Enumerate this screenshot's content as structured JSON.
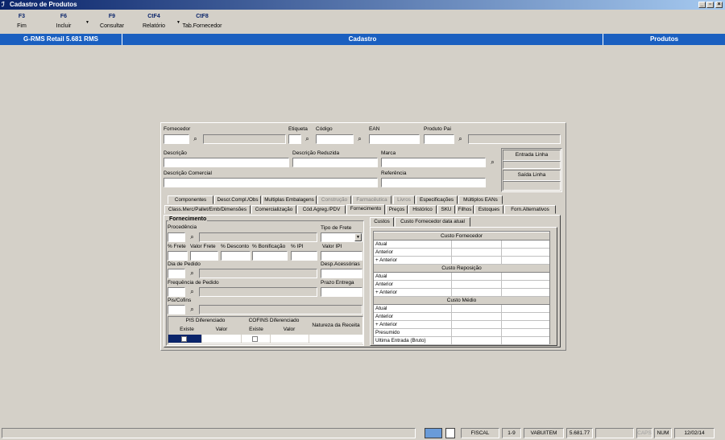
{
  "window": {
    "title": "Cadastro de Produtos"
  },
  "toolbar": [
    {
      "key": "F3",
      "label": "Fim"
    },
    {
      "key": "F6",
      "label": "Incluir"
    },
    {
      "key": "F9",
      "label": "Consultar"
    },
    {
      "key": "CtF4",
      "label": "Relatório"
    },
    {
      "key": "CtF8",
      "label": "Tab.Fornecedor"
    }
  ],
  "header": {
    "app": "G-RMS Retail 5.681 RMS",
    "section": "Cadastro",
    "module": "Produtos"
  },
  "fields": {
    "fornecedor": "Fornecedor",
    "etiqueta": "Etiqueta",
    "codigo": "Código",
    "ean": "EAN",
    "produto_pai": "Produto Pai",
    "descricao": "Descrição",
    "descricao_reduzida": "Descrição Reduzida",
    "marca": "Marca",
    "descricao_comercial": "Descrição Comercial",
    "referencia": "Referência",
    "entrada_linha": "Entrada Linha",
    "saida_linha": "Saída Linha"
  },
  "tabs_row1": [
    {
      "label": "Componentes",
      "enabled": true
    },
    {
      "label": "Descr.Compl./Obs",
      "enabled": true
    },
    {
      "label": "Multiplas Embalagens",
      "enabled": true
    },
    {
      "label": "Construção",
      "enabled": false
    },
    {
      "label": "Farmacêutica",
      "enabled": false
    },
    {
      "label": "Livros",
      "enabled": false
    },
    {
      "label": "Especificações",
      "enabled": true
    },
    {
      "label": "Múltiplos EANs",
      "enabled": true
    }
  ],
  "tabs_row2": [
    {
      "label": "Class.Merc/Pallet/Emb/Dimensões"
    },
    {
      "label": "Comercialização"
    },
    {
      "label": "Cód.Agreg./PDV"
    },
    {
      "label": "Fornecimento"
    },
    {
      "label": "Preços"
    },
    {
      "label": "Histórico"
    },
    {
      "label": "SKU"
    },
    {
      "label": "Filhos"
    },
    {
      "label": "Estoques"
    },
    {
      "label": "Forn.Alternativos"
    }
  ],
  "fornecimento": {
    "group_title": "Fornecimento",
    "procedencia": "Procedência",
    "tipo_frete": "Tipo de Frete",
    "pct_frete": "% Frete",
    "valor_frete": "Valor Frete",
    "pct_desconto": "% Desconto",
    "pct_bonificacao": "% Bonificação",
    "pct_ipi": "% IPI",
    "valor_ipi": "Valor IPI",
    "dia_pedido": "Dia de Pedido",
    "desp_acessorias": "Desp.Acessórias",
    "frequencia_pedido": "Frequência de Pedido",
    "prazo_entrega": "Prazo Entrega",
    "pis_cofins": "Pis/Cofins",
    "pis_dif": "PIS Diferenciado",
    "cofins_dif": "COFINS Diferenciado",
    "natureza_receita": "Natureza da Receita",
    "existe": "Existe",
    "valor": "Valor"
  },
  "custos": {
    "tabs": [
      "Custos",
      "Custo Fornecedor data atual"
    ],
    "sections": [
      {
        "title": "Custo Fornecedor",
        "rows": [
          "Atual",
          "Anterior",
          "+ Anterior"
        ]
      },
      {
        "title": "Custo Reposição",
        "rows": [
          "Atual",
          "Anterior",
          "+ Anterior"
        ]
      },
      {
        "title": "Custo Médio",
        "rows": [
          "Atual",
          "Anterior",
          "+ Anterior",
          "Presumido",
          "Ultima Entrada (Bruto)"
        ]
      }
    ]
  },
  "statusbar": {
    "fiscal": "FISCAL",
    "range": "1-9",
    "user": "VABUITEM",
    "version": "5.681.77",
    "caps": "CAPS",
    "num": "NUM",
    "date": "12/02/14"
  }
}
